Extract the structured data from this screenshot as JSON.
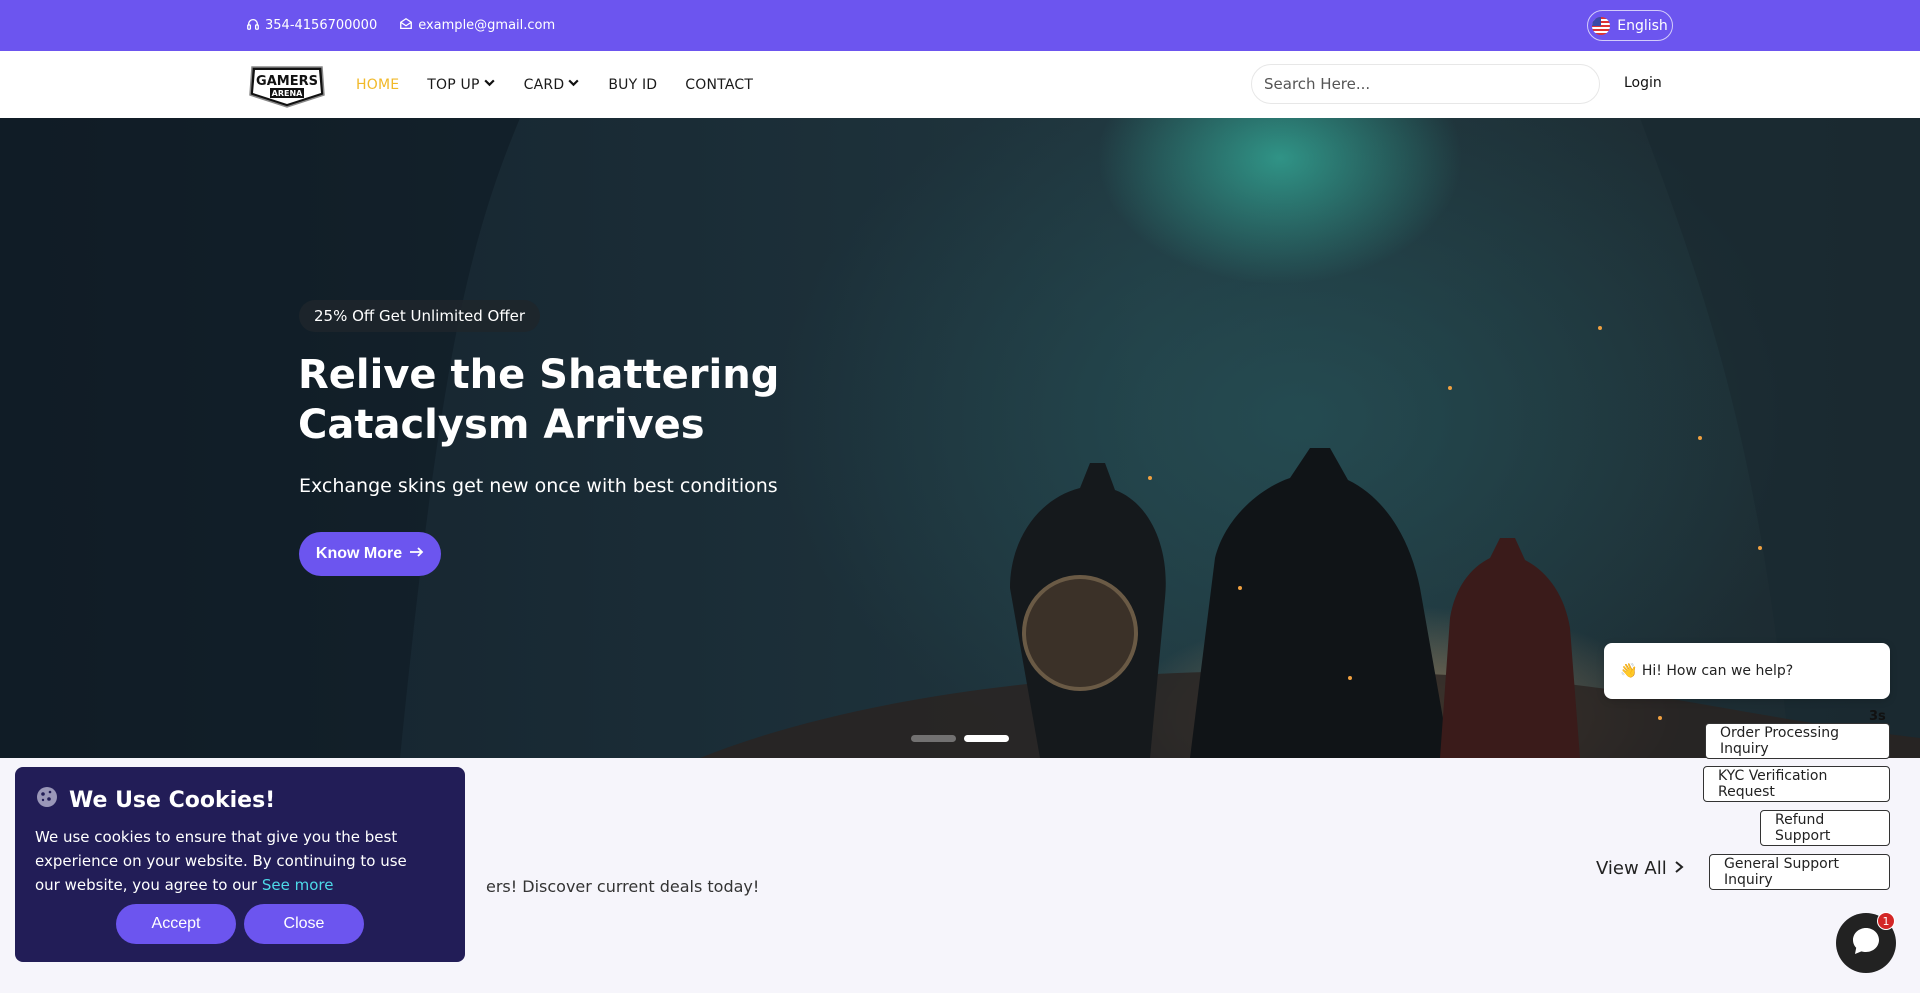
{
  "topbar": {
    "phone": "354-4156700000",
    "email": "example@gmail.com",
    "language": "English"
  },
  "nav": {
    "logo_text": "GAMERS ARENA",
    "links": [
      {
        "label": "HOME",
        "active": true
      },
      {
        "label": "TOP UP",
        "dropdown": true
      },
      {
        "label": "CARD",
        "dropdown": true
      },
      {
        "label": "BUY ID"
      },
      {
        "label": "CONTACT"
      }
    ],
    "search_placeholder": "Search Here...",
    "login": "Login"
  },
  "hero": {
    "badge": "25% Off Get Unlimited Offer",
    "title": "Relive the Shattering Cataclysm Arrives",
    "subtitle": "Exchange skins get new once with best conditions",
    "cta": "Know More",
    "slides": 2,
    "active_slide": 2
  },
  "section": {
    "description_partial": "ers! Discover current deals today!",
    "view_all": "View All"
  },
  "cookie": {
    "title": "We Use Cookies!",
    "text": "We use cookies to ensure that give you the best experience on your website. By continuing to use our website, you agree to our",
    "link": "See more",
    "accept": "Accept",
    "close": "Close"
  },
  "chat": {
    "greeting": "👋 Hi! How can we help?",
    "timer": "3s",
    "options": [
      "Order Processing Inquiry",
      "KYC Verification Request",
      "Refund Support",
      "General Support Inquiry"
    ],
    "unread": "1"
  },
  "colors": {
    "brand": "#6c55ef",
    "active_nav": "#f1b929",
    "cookie_bg": "#221d57"
  }
}
